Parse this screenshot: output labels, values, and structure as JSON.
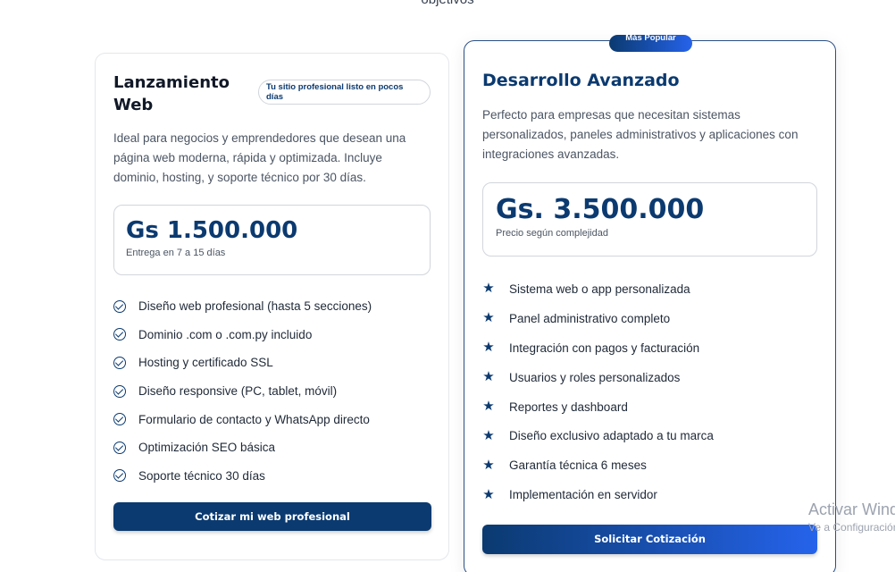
{
  "header": {
    "subtitle_cut": "objetivos"
  },
  "plan_basic": {
    "title": "Lanzamiento Web",
    "badge": "Tu sitio profesional listo en pocos días",
    "description": "Ideal para negocios y emprendedores que desean una página web moderna, rápida y optimizada. Incluye dominio, hosting, y soporte técnico por 30 días.",
    "price": "Gs 1.500.000",
    "price_note": "Entrega en 7 a 15 días",
    "features": [
      "Diseño web profesional (hasta 5 secciones)",
      "Dominio .com o .com.py incluido",
      "Hosting y certificado SSL",
      "Diseño responsive (PC, tablet, móvil)",
      "Formulario de contacto y WhatsApp directo",
      "Optimización SEO básica",
      "Soporte técnico 30 días"
    ],
    "feature_icon": "check-circle-icon",
    "button_label": "Cotizar mi web profesional"
  },
  "plan_advanced": {
    "popular_label": "Más Popular",
    "title": "Desarrollo Avanzado",
    "description": "Perfecto para empresas que necesitan sistemas personalizados, paneles administrativos y aplicaciones con integraciones avanzadas.",
    "price": "Gs. 3.500.000",
    "price_note": "Precio según complejidad",
    "features": [
      "Sistema web o app personalizada",
      "Panel administrativo completo",
      "Integración con pagos y facturación",
      "Usuarios y roles personalizados",
      "Reportes y dashboard",
      "Diseño exclusivo adaptado a tu marca",
      "Garantía técnica 6 meses",
      "Implementación en servidor"
    ],
    "feature_icon": "star-icon",
    "button_label": "Solicitar Cotización"
  },
  "watermark": {
    "line1": "Activar Windows",
    "line2": "Ve a Configuración para activar Windows."
  },
  "colors": {
    "brand": "#0b3a70",
    "accent": "#2563eb",
    "text": "#1f2937",
    "muted": "#4b5563",
    "border": "#e5e7eb"
  }
}
